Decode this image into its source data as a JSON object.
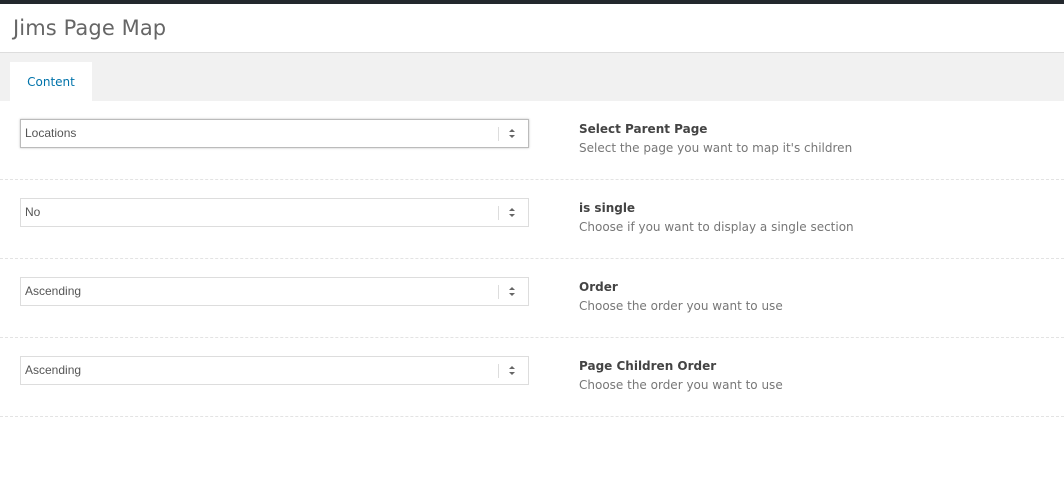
{
  "page": {
    "title": "Jims Page Map"
  },
  "tabs": [
    {
      "label": "Content",
      "active": true
    }
  ],
  "fields": [
    {
      "label": "Select Parent Page",
      "description": "Select the page you want to map it's children",
      "value": "Locations"
    },
    {
      "label": "is single",
      "description": "Choose if you want to display a single section",
      "value": "No"
    },
    {
      "label": "Order",
      "description": "Choose the order you want to use",
      "value": "Ascending"
    },
    {
      "label": "Page Children Order",
      "description": "Choose the order you want to use",
      "value": "Ascending"
    }
  ],
  "colors": {
    "accent": "#0073aa",
    "top_strip": "#23282d",
    "tabbar_bg": "#f1f1f1"
  },
  "icons": {
    "select_arrow": "up-down-arrows-icon"
  }
}
